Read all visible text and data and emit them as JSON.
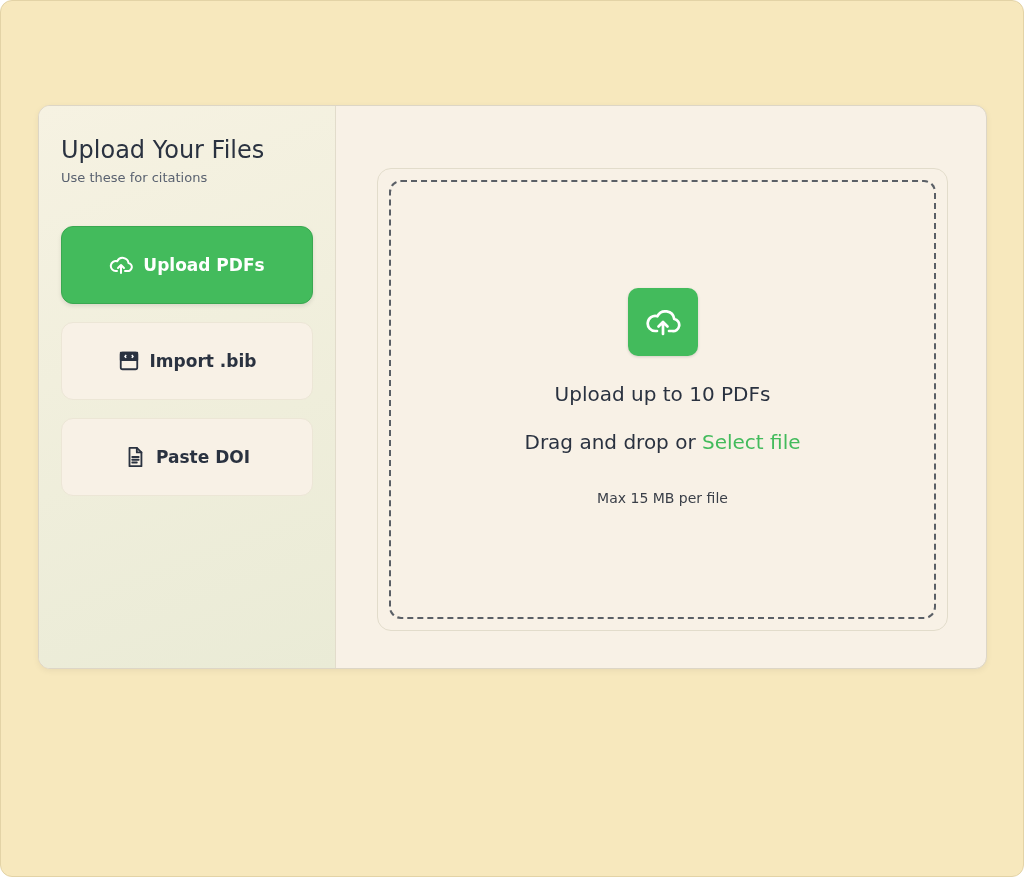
{
  "sidebar": {
    "title": "Upload Your Files",
    "subtitle": "Use these for citations",
    "options": [
      {
        "label": "Upload PDFs",
        "selected": true
      },
      {
        "label": "Import .bib",
        "selected": false
      },
      {
        "label": "Paste DOI",
        "selected": false
      }
    ]
  },
  "dropzone": {
    "heading": "Upload up to 10 PDFs",
    "prompt": "Drag and drop or ",
    "link": "Select file",
    "note": "Max 15 MB per file"
  }
}
